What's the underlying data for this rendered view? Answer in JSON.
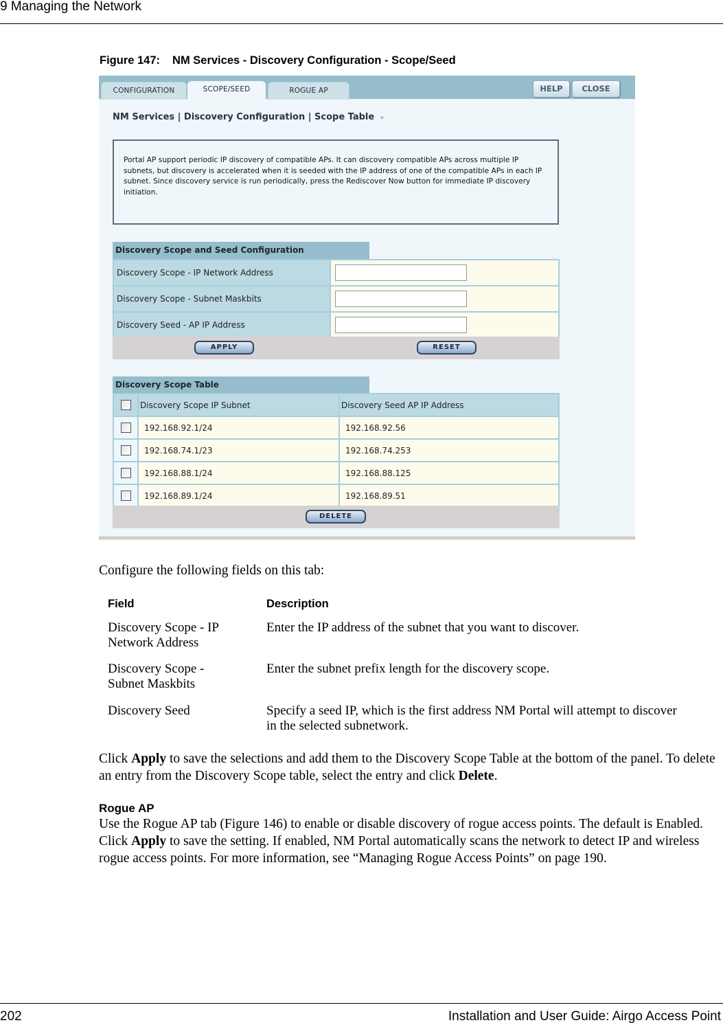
{
  "page": {
    "running_header": "9  Managing the Network",
    "footer_page_number": "202",
    "footer_title": "Installation and User Guide: Airgo Access Point"
  },
  "figure": {
    "number": "Figure 147:",
    "title": "NM Services - Discovery Configuration - Scope/Seed"
  },
  "app": {
    "tabs": [
      {
        "label": "CONFIGURATION",
        "active": false
      },
      {
        "label": "SCOPE/SEED",
        "active": true
      },
      {
        "label": "ROGUE AP",
        "active": false
      }
    ],
    "help_label": "HELP",
    "close_label": "CLOSE",
    "breadcrumb": "NM Services | Discovery Configuration | Scope Table",
    "breadcrumb_arrows": "»",
    "info_text": "Portal AP support periodic IP discovery of compatible APs. It can discovery compatible APs across multiple IP subnets, but discovery is accelerated when it is seeded with the IP address of one of the compatible APs in each IP subnet. Since discovery service is run periodically, press the Rediscover Now button for immediate IP discovery initiation.",
    "config_section": {
      "title": "Discovery Scope and Seed Configuration",
      "fields": [
        {
          "label": "Discovery Scope - IP Network Address",
          "value": ""
        },
        {
          "label": "Discovery Scope - Subnet Maskbits",
          "value": ""
        },
        {
          "label": "Discovery Seed - AP IP Address",
          "value": ""
        }
      ],
      "apply_label": "APPLY",
      "reset_label": "RESET"
    },
    "scope_table": {
      "title": "Discovery Scope Table",
      "columns": [
        "Discovery Scope IP Subnet",
        "Discovery Seed AP IP Address"
      ],
      "rows": [
        {
          "subnet": "192.168.92.1/24",
          "seed": "192.168.92.56",
          "checked": false
        },
        {
          "subnet": "192.168.74.1/23",
          "seed": "192.168.74.253",
          "checked": false
        },
        {
          "subnet": "192.168.88.1/24",
          "seed": "192.168.88.125",
          "checked": false
        },
        {
          "subnet": "192.168.89.1/24",
          "seed": "192.168.89.51",
          "checked": false
        }
      ],
      "delete_label": "DELETE"
    }
  },
  "doc": {
    "intro": "Configure the following fields on this tab:",
    "field_table": {
      "header_field": "Field",
      "header_description": "Description",
      "rows": [
        {
          "field": "Discovery Scope - IP Network Address",
          "description": "Enter the IP address of the subnet that you want to discover."
        },
        {
          "field": "Discovery Scope - Subnet Maskbits",
          "description": "Enter the subnet prefix length for the discovery scope."
        },
        {
          "field": "Discovery Seed",
          "description": "Specify a seed IP, which is the first address NM Portal will attempt to discover in the selected subnetwork."
        }
      ]
    },
    "para1": {
      "p1": "Click ",
      "b1": "Apply",
      "p2": " to save the selections and add them to the Discovery Scope Table at the bottom of the panel. To delete an entry from the Discovery Scope table, select the entry and click ",
      "b2": "Delete",
      "p3": "."
    },
    "rogue_heading": "Rogue AP",
    "para2": {
      "p1": "Use the Rogue AP tab (Figure 146) to enable or disable discovery of rogue access points. The default is Enabled. Click ",
      "b1": "Apply",
      "p2": " to save the setting. If enabled, NM Portal automatically scans the network to detect IP and wireless rogue access points. For more information, see “Managing Rogue Access Points” on page 190."
    }
  }
}
